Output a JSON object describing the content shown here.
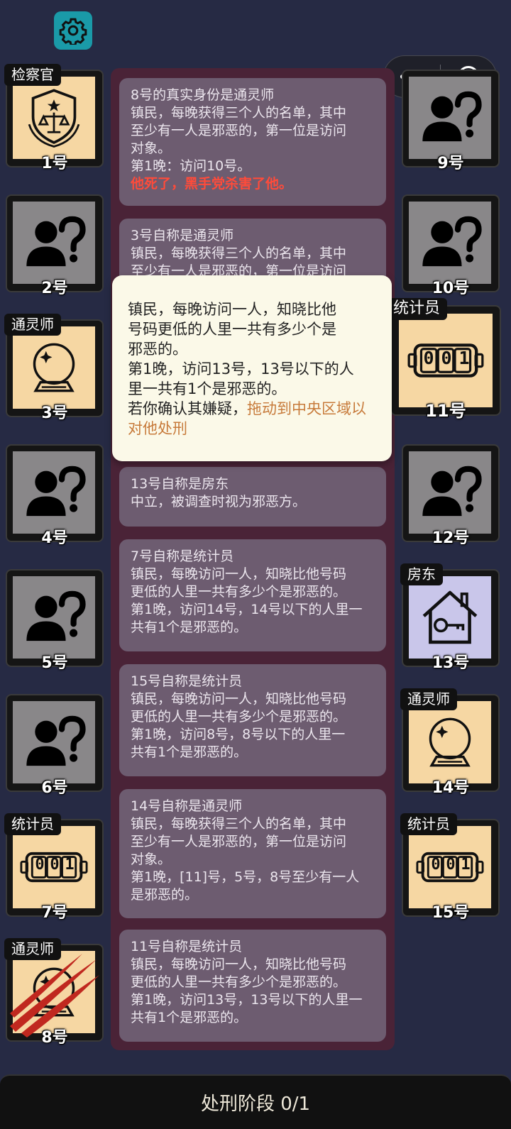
{
  "phase_bar": {
    "label": "处刑阶段 0/1"
  },
  "icons": {
    "settings": "gear-icon",
    "menu": "more-dots-icon",
    "close": "target-icon"
  },
  "colors": {
    "background": "#262a44",
    "settings_button": "#1a9aa8",
    "log_panel": "#4a2337",
    "log_card": "#6d5c70",
    "death_text": "#ff4b3a",
    "hint_highlight": "#c77a3a",
    "role_peach": "#f6d7a3",
    "role_lavender": "#c9c6ea",
    "unknown_gray": "#898789"
  },
  "players_left": [
    {
      "num": "1号",
      "role": "检察官",
      "icon": "prosecutor-badge-icon"
    },
    {
      "num": "2号",
      "role": "",
      "icon": "unknown-person-icon"
    },
    {
      "num": "3号",
      "role": "通灵师",
      "icon": "crystal-ball-icon"
    },
    {
      "num": "4号",
      "role": "",
      "icon": "unknown-person-icon"
    },
    {
      "num": "5号",
      "role": "",
      "icon": "unknown-person-icon"
    },
    {
      "num": "6号",
      "role": "",
      "icon": "unknown-person-icon"
    },
    {
      "num": "7号",
      "role": "统计员",
      "icon": "counter-icon"
    },
    {
      "num": "8号",
      "role": "通灵师",
      "icon": "crystal-ball-icon",
      "dead": true
    }
  ],
  "players_right": [
    {
      "num": "9号",
      "role": "",
      "icon": "unknown-person-icon"
    },
    {
      "num": "10号",
      "role": "",
      "icon": "unknown-person-icon"
    },
    {
      "num": "11号",
      "role": "统计员",
      "icon": "counter-icon",
      "selected": true
    },
    {
      "num": "12号",
      "role": "",
      "icon": "unknown-person-icon"
    },
    {
      "num": "13号",
      "role": "房东",
      "icon": "house-key-icon"
    },
    {
      "num": "14号",
      "role": "通灵师",
      "icon": "crystal-ball-icon"
    },
    {
      "num": "15号",
      "role": "统计员",
      "icon": "counter-icon"
    }
  ],
  "counter_digits": "001",
  "log": [
    {
      "title": "8号的真实身份是通灵师",
      "lines": [
        "镇民，每晚获得三个人的名单，其中",
        "至少有一人是邪恶的，第一位是访问",
        "对象。",
        "第1晚：访问10号。"
      ],
      "death": "他死了，黑手党杀害了他。"
    },
    {
      "title": "3号自称是通灵师",
      "lines": [
        "镇民，每晚获得三个人的名单，其中",
        "至少有一人是邪恶的，第一位是访问"
      ]
    },
    {
      "title": "13号自称是房东",
      "lines": [
        "中立，被调查时视为邪恶方。"
      ]
    },
    {
      "title": "7号自称是统计员",
      "lines": [
        "镇民，每晚访问一人，知晓比他号码",
        "更低的人里一共有多少个是邪恶的。",
        "第1晚，访问14号，14号以下的人里一",
        "共有1个是邪恶的。"
      ]
    },
    {
      "title": "15号自称是统计员",
      "lines": [
        "镇民，每晚访问一人，知晓比他号码",
        "更低的人里一共有多少个是邪恶的。",
        "第1晚，访问8号，8号以下的人里一",
        "共有1个是邪恶的。"
      ]
    },
    {
      "title": "14号自称是通灵师",
      "lines": [
        "镇民，每晚获得三个人的名单，其中",
        "至少有一人是邪恶的，第一位是访问",
        "对象。",
        "第1晚，[11]号，5号，8号至少有一人",
        "是邪恶的。"
      ]
    },
    {
      "title": "11号自称是统计员",
      "lines": [
        "镇民，每晚访问一人，知晓比他号码",
        "更低的人里一共有多少个是邪恶的。",
        "第1晚，访问13号，13号以下的人里一",
        "共有1个是邪恶的。"
      ]
    }
  ],
  "tooltip": {
    "lines": [
      "镇民，每晚访问一人，知晓比他",
      "号码更低的人里一共有多少个是",
      "邪恶的。",
      "第1晚，访问13号，13号以下的人",
      "里一共有1个是邪恶的。"
    ],
    "prompt": "若你确认其嫌疑，",
    "action": "拖动到中央区域以对他处刑"
  }
}
